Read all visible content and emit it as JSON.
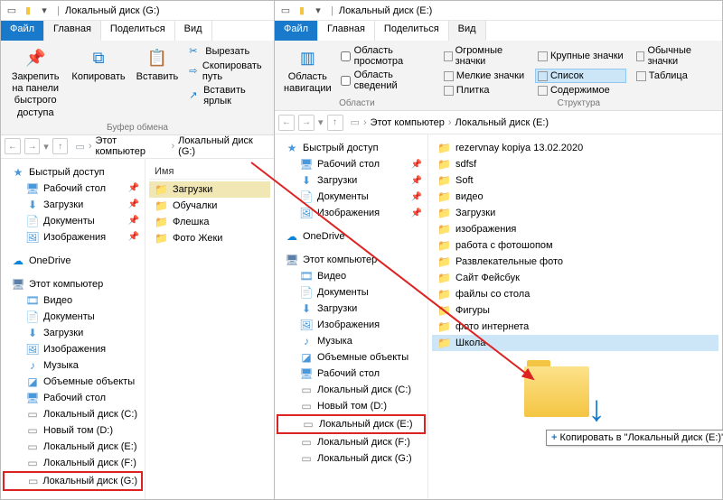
{
  "w1": {
    "title": "Локальный диск (G:)",
    "tabs": {
      "file": "Файл",
      "home": "Главная",
      "share": "Поделиться",
      "view": "Вид"
    },
    "ribbon": {
      "pin": "Закрепить на панели\nбыстрого доступа",
      "copy": "Копировать",
      "paste": "Вставить",
      "cut": "Вырезать",
      "copypath": "Скопировать путь",
      "pastelnk": "Вставить ярлык",
      "group": "Буфер обмена"
    },
    "crumbs": [
      "Этот компьютер",
      "Локальный диск (G:)"
    ],
    "colhdr": "Имя",
    "tree": {
      "quick": "Быстрый доступ",
      "quickItems": [
        "Рабочий стол",
        "Загрузки",
        "Документы",
        "Изображения"
      ],
      "onedrive": "OneDrive",
      "thispc": "Этот компьютер",
      "pcItems": [
        "Видео",
        "Документы",
        "Загрузки",
        "Изображения",
        "Музыка",
        "Объемные объекты",
        "Рабочий стол",
        "Локальный диск (C:)",
        "Новый том (D:)",
        "Локальный диск (E:)",
        "Локальный диск (F:)",
        "Локальный диск (G:)"
      ]
    },
    "files": [
      "Загрузки",
      "Обучалки",
      "Флешка",
      "Фото Жеки"
    ]
  },
  "w2": {
    "title": "Локальный диск (E:)",
    "tabs": {
      "file": "Файл",
      "home": "Главная",
      "share": "Поделиться",
      "view": "Вид"
    },
    "ribbon": {
      "navpane": "Область\nнавигации",
      "preview": "Область просмотра",
      "details": "Область сведений",
      "group1": "Области",
      "views": [
        "Огромные значки",
        "Крупные значки",
        "Обычные значки",
        "Мелкие значки",
        "Список",
        "Таблица",
        "Плитка",
        "Содержимое"
      ],
      "group2": "Структура"
    },
    "crumbs": [
      "Этот компьютер",
      "Локальный диск (E:)"
    ],
    "tree": {
      "quick": "Быстрый доступ",
      "quickItems": [
        "Рабочий стол",
        "Загрузки",
        "Документы",
        "Изображения"
      ],
      "onedrive": "OneDrive",
      "thispc": "Этот компьютер",
      "pcItems": [
        "Видео",
        "Документы",
        "Загрузки",
        "Изображения",
        "Музыка",
        "Объемные объекты",
        "Рабочий стол",
        "Локальный диск (C:)",
        "Новый том (D:)",
        "Локальный диск (E:)",
        "Локальный диск (F:)",
        "Локальный диск (G:)"
      ]
    },
    "files": [
      "rezervnay kopiya 13.02.2020",
      "sdfsf",
      "Soft",
      "видео",
      "Загрузки",
      "изображения",
      "работа с фотошопом",
      "Развлекательные фото",
      "Сайт Фейсбук",
      "файлы со стола",
      "Фигуры",
      "фото интернета",
      "Школа"
    ],
    "tooltip": "Копировать в \"Локальный диск (E:)\""
  }
}
